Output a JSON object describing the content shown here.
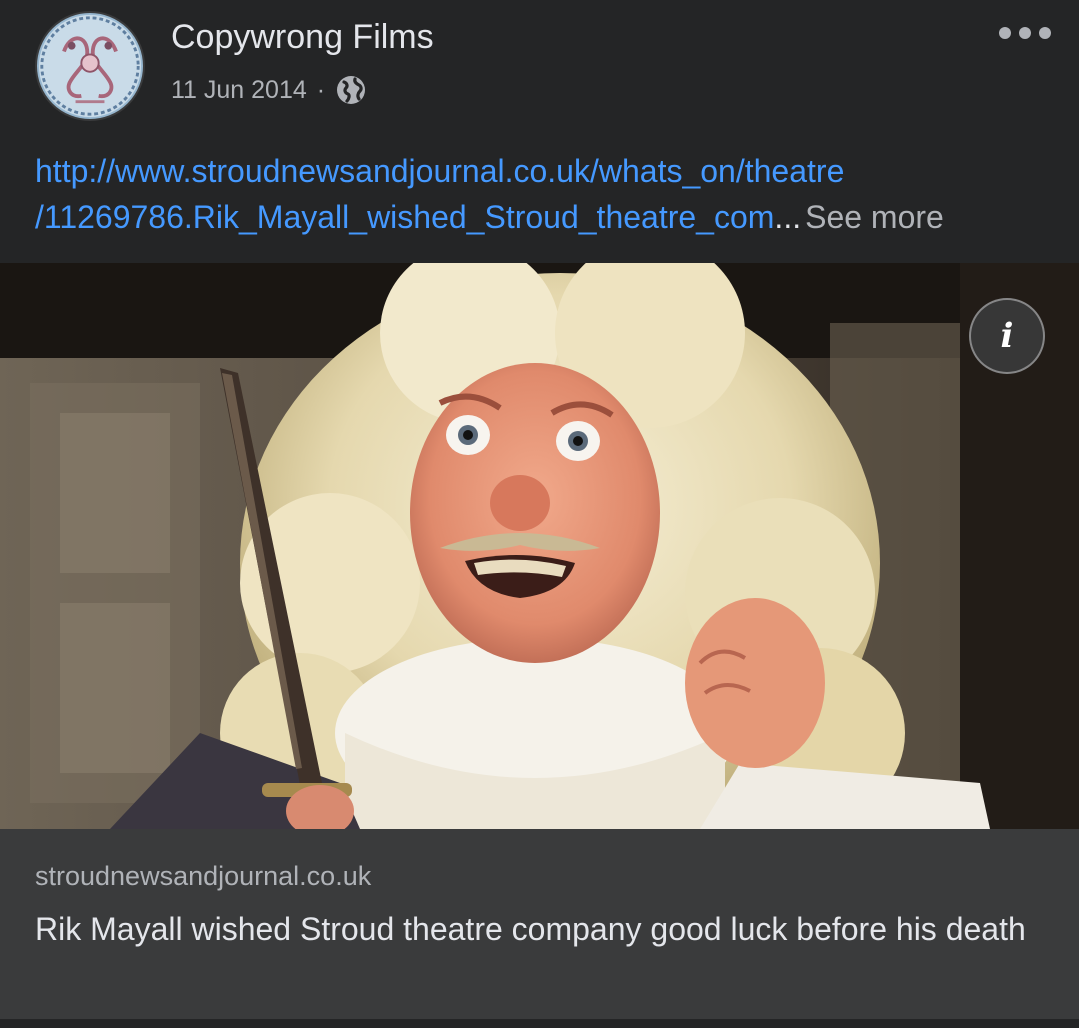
{
  "post": {
    "author": "Copywrong Films",
    "date": "11 Jun 2014",
    "separator": "·",
    "privacy_icon": "globe-icon",
    "menu_icon": "more-options-icon",
    "text": {
      "link_line1": "http://www.stroudnewsandjournal.co.uk/whats_on/theatre",
      "link_line2": "/11269786.Rik_Mayall_wished_Stroud_theatre_com",
      "ellipsis": "...",
      "see_more": "See more"
    },
    "link_preview": {
      "info_glyph": "i",
      "domain": "stroudnewsandjournal.co.uk",
      "title": "Rik Mayall wished Stroud theatre company good luck before his death"
    }
  },
  "colors": {
    "background": "#242526",
    "link": "#4599ff",
    "secondary_text": "#b0b3b8",
    "primary_text": "#e4e6eb",
    "preview_footer": "#3a3b3c"
  }
}
